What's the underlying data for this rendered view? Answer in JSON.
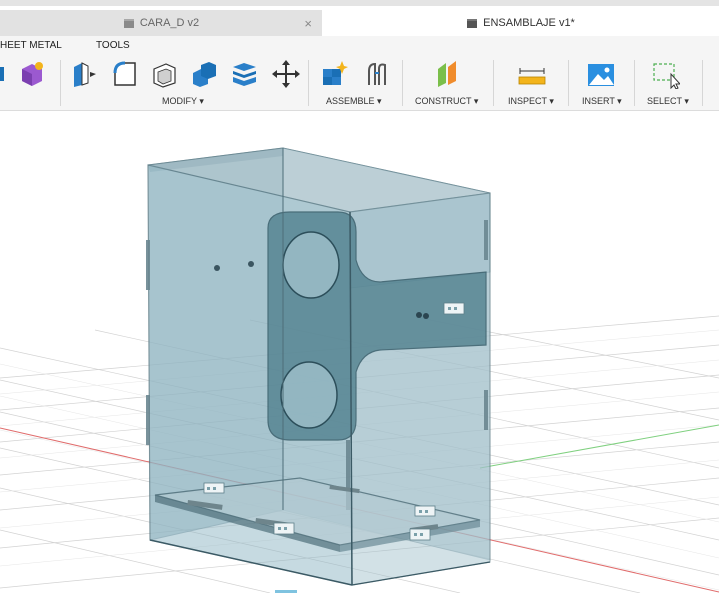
{
  "tabs": [
    {
      "label": "CARA_D v2",
      "active": false,
      "close": "×"
    },
    {
      "label": "ENSAMBLAJE v1*",
      "active": true
    }
  ],
  "menus": [
    "HEET METAL",
    "TOOLS"
  ],
  "toolbar_groups": {
    "modify": "MODIFY ▾",
    "assemble": "ASSEMBLE ▾",
    "construct": "CONSTRUCT ▾",
    "inspect": "INSPECT ▾",
    "insert": "INSERT ▾",
    "select": "SELECT ▾"
  },
  "icons": [
    "create-sketch-icon",
    "create-form-icon",
    "press-pull-icon",
    "fillet-icon",
    "shell-icon",
    "combine-icon",
    "split-body-icon",
    "move-icon",
    "new-component-icon",
    "joint-icon",
    "offset-plane-icon",
    "measure-icon",
    "insert-image-icon",
    "select-box-icon"
  ],
  "colors": {
    "accent": "#1a6fb5",
    "body_glass": "#8fb6c4",
    "plate_dark": "#4f7f8d",
    "grid": "#c9c9c9",
    "axis_red": "#e06c6c",
    "axis_green": "#7fd07f"
  }
}
